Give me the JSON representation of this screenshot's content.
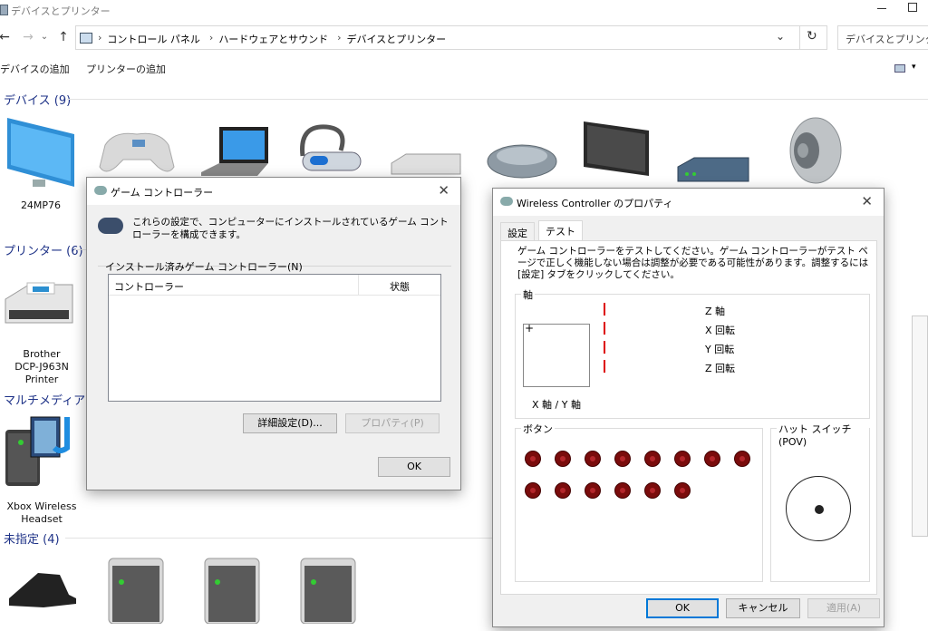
{
  "window": {
    "title": "デバイスとプリンター"
  },
  "address": {
    "crumbs": [
      "コントロール パネル",
      "ハードウェアとサウンド",
      "デバイスとプリンター"
    ],
    "search_placeholder": "デバイスとプリンターの"
  },
  "commands": {
    "add_device": "デバイスの追加",
    "add_printer": "プリンターの追加"
  },
  "groups": {
    "devices": "デバイス (9)",
    "printers": "プリンター (6)",
    "multimedia": "マルチメディア デバ",
    "unspecified": "未指定 (4)"
  },
  "devices": {
    "monitor": "24MP76",
    "printer_l1": "Brother",
    "printer_l2": "DCP-J963N",
    "printer_l3": "Printer",
    "headset_l1": "Xbox Wireless",
    "headset_l2": "Headset"
  },
  "game_controllers_dialog": {
    "title": "ゲーム コントローラー",
    "info": "これらの設定で、コンピューターにインストールされているゲーム コントローラーを構成できます。",
    "group_label": "インストール済みゲーム コントローラー(N)",
    "col_controller": "コントローラー",
    "col_status": "状態",
    "advanced_button": "詳細設定(D)...",
    "properties_button": "プロパティ(P)",
    "ok_button": "OK"
  },
  "wireless_dialog": {
    "title": "Wireless Controller のプロパティ",
    "tab_settings": "設定",
    "tab_test": "テスト",
    "description": "ゲーム コントローラーをテストしてください。ゲーム コントローラーがテスト ページで正しく機能しない場合は調整が必要である可能性があります。調整するには [設定] タブをクリックしてください。",
    "axes_label": "軸",
    "z_axis": "Z 軸",
    "x_rotation": "X 回転",
    "y_rotation": "Y 回転",
    "z_rotation": "Z 回転",
    "xy_axis": "X 軸 / Y 軸",
    "buttons_label": "ボタン",
    "hat_label": "ハット スイッチ (POV)",
    "ok_button": "OK",
    "cancel_button": "キャンセル",
    "apply_button": "適用(A)"
  }
}
